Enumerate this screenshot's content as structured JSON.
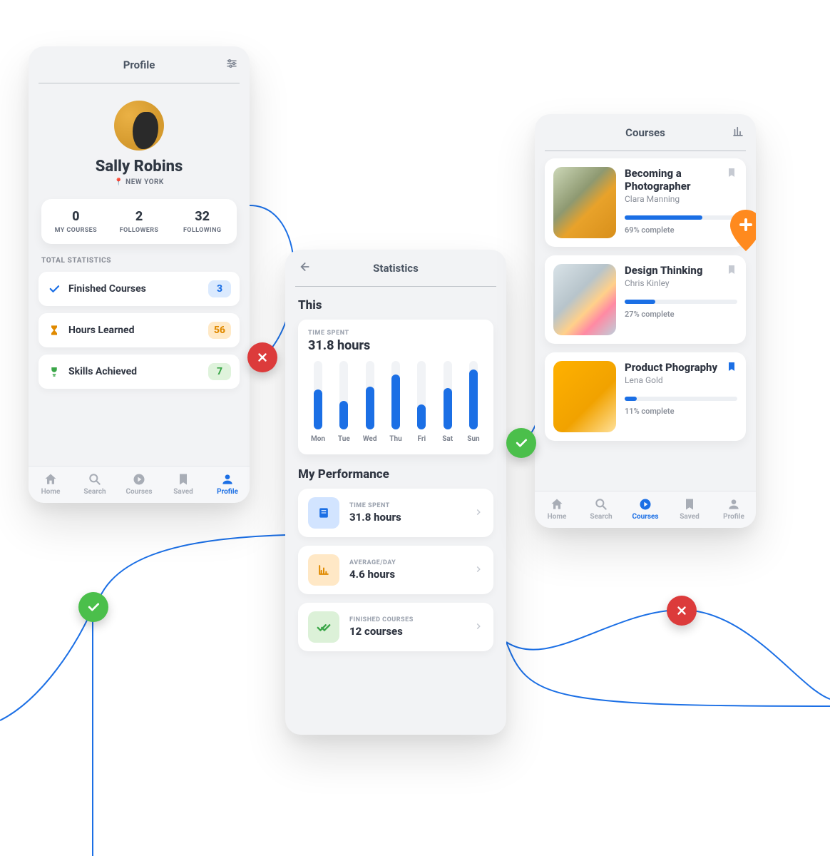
{
  "profile": {
    "title": "Profile",
    "name": "Sally Robins",
    "location_prefix": "📍",
    "location": "NEW YORK",
    "stats": [
      {
        "value": "0",
        "label": "MY COURSES"
      },
      {
        "value": "2",
        "label": "FOLLOWERS"
      },
      {
        "value": "32",
        "label": "FOLLOWING"
      }
    ],
    "section_label": "TOTAL STATISTICS",
    "stat_cards": [
      {
        "icon": "check",
        "label": "Finished Courses",
        "badge": "3",
        "color": "blue"
      },
      {
        "icon": "hourglass",
        "label": "Hours Learned",
        "badge": "56",
        "color": "orange"
      },
      {
        "icon": "trophy",
        "label": "Skills Achieved",
        "badge": "7",
        "color": "green"
      }
    ],
    "nav": [
      "Home",
      "Search",
      "Courses",
      "Saved",
      "Profile"
    ],
    "nav_active": "Profile"
  },
  "statistics": {
    "title": "Statistics",
    "heading": "This",
    "time_card": {
      "label": "TIME SPENT",
      "value": "31.8 hours"
    },
    "week": {
      "days": [
        "Mon",
        "Tue",
        "Wed",
        "Thu",
        "Fri",
        "Sat",
        "Sun"
      ],
      "values": [
        58,
        42,
        62,
        80,
        36,
        60,
        88
      ]
    },
    "perf_heading": "My Performance",
    "perf": [
      {
        "icon": "book",
        "color": "blue",
        "label": "TIME SPENT",
        "value": "31.8 hours"
      },
      {
        "icon": "chart",
        "color": "orange",
        "label": "AVERAGE/DAY",
        "value": "4.6 hours"
      },
      {
        "icon": "dblcheck",
        "color": "green",
        "label": "FINISHED COURSES",
        "value": "12 courses"
      }
    ]
  },
  "courses": {
    "title": "Courses",
    "list": [
      {
        "title": "Becoming a Photographer",
        "author": "Clara Manning",
        "progress": 69,
        "progress_text": "69% complete",
        "bookmarked": false
      },
      {
        "title": "Design Thinking",
        "author": "Chris Kinley",
        "progress": 27,
        "progress_text": "27% complete",
        "bookmarked": false
      },
      {
        "title": "Product Phography",
        "author": "Lena Gold",
        "progress": 11,
        "progress_text": "11% complete",
        "bookmarked": true
      }
    ],
    "nav": [
      "Home",
      "Search",
      "Courses",
      "Saved",
      "Profile"
    ],
    "nav_active": "Courses"
  },
  "chart_data": {
    "type": "bar",
    "categories": [
      "Mon",
      "Tue",
      "Wed",
      "Thu",
      "Fri",
      "Sat",
      "Sun"
    ],
    "values": [
      58,
      42,
      62,
      80,
      36,
      60,
      88
    ],
    "title": "Time Spent",
    "ylabel": "",
    "xlabel": "",
    "ylim": [
      0,
      100
    ]
  }
}
